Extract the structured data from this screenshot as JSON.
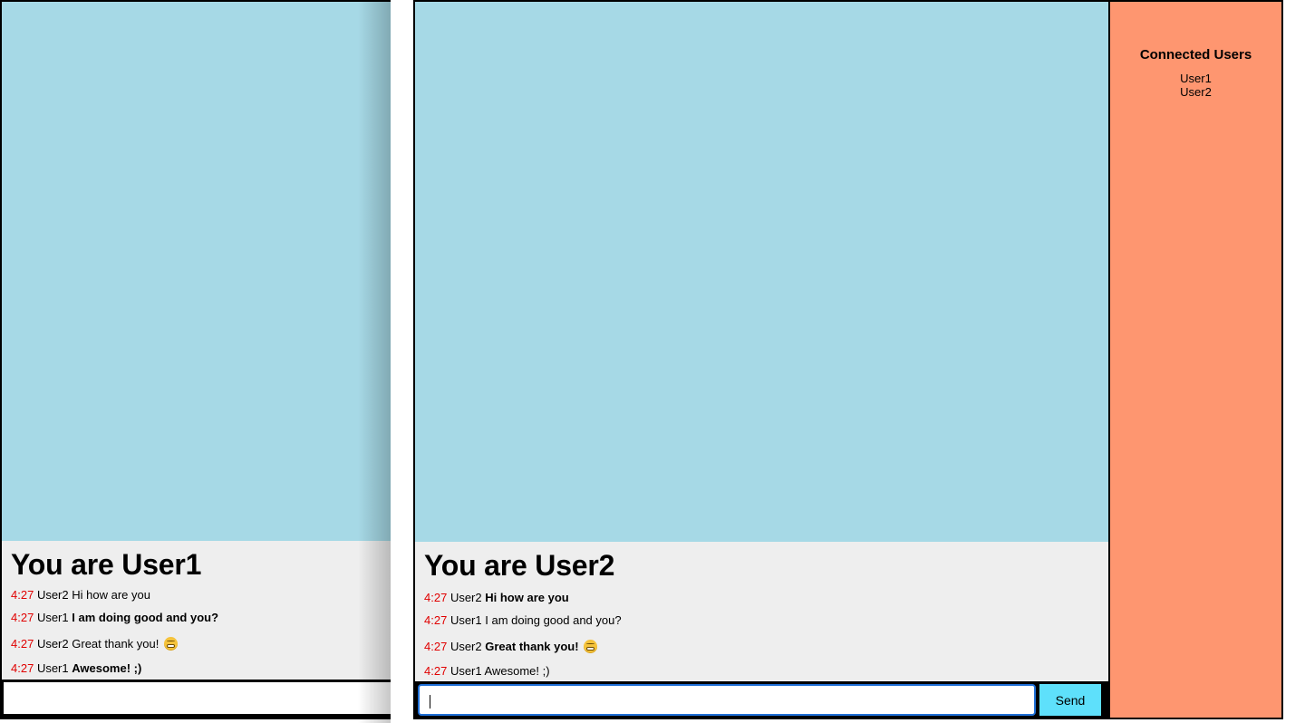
{
  "left_window": {
    "title": "You are User1",
    "messages": [
      {
        "time": "4:27",
        "user": "User2",
        "text": "Hi how are you",
        "bold": false,
        "emoji": false
      },
      {
        "time": "4:27",
        "user": "User1",
        "text": "I am doing good and you?",
        "bold": true,
        "emoji": false
      },
      {
        "time": "4:27",
        "user": "User2",
        "text": "Great thank you!",
        "bold": false,
        "emoji": true
      },
      {
        "time": "4:27",
        "user": "User1",
        "text": "Awesome! ;)",
        "bold": true,
        "emoji": false
      }
    ]
  },
  "right_window": {
    "title": "You are User2",
    "messages": [
      {
        "time": "4:27",
        "user": "User2",
        "text": "Hi how are you",
        "bold": true,
        "emoji": false
      },
      {
        "time": "4:27",
        "user": "User1",
        "text": "I am doing good and you?",
        "bold": false,
        "emoji": false
      },
      {
        "time": "4:27",
        "user": "User2",
        "text": "Great thank you!",
        "bold": true,
        "emoji": true
      },
      {
        "time": "4:27",
        "user": "User1",
        "text": "Awesome! ;)",
        "bold": false,
        "emoji": false
      }
    ],
    "send_label": "Send",
    "sidebar": {
      "heading": "Connected Users",
      "users": [
        "User1",
        "User2"
      ]
    }
  },
  "colors": {
    "chat_area": "#a6d9e6",
    "panel": "#eeeeee",
    "sidebar": "#fe9670",
    "timestamp": "#e00000",
    "send_button": "#5ee0fb"
  },
  "icons": {
    "emoji": "grimacing-face-emoji"
  }
}
